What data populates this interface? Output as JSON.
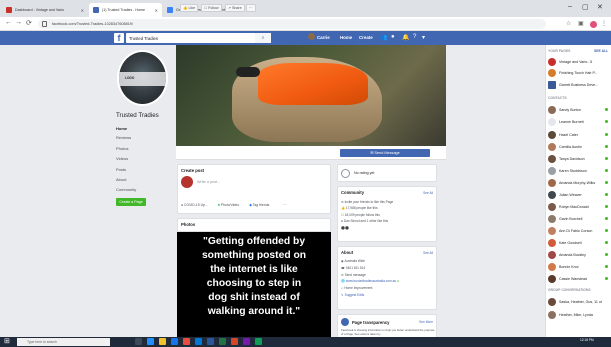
{
  "browser": {
    "tabs": [
      {
        "label": "Dashboard - Vintage and Vario",
        "color": "#c9302c"
      },
      {
        "label": "(1) Trusted Tradies - Home",
        "color": "#4267b2"
      },
      {
        "label": "Garrett Business Development",
        "color": "#3b82f6"
      }
    ],
    "url": "facebook.com/Trusted-Tradies-1028347608819/"
  },
  "fb": {
    "search_value": "Trusted Tradies",
    "nav": {
      "user": "Carrie",
      "home": "Home",
      "create": "Create"
    }
  },
  "page": {
    "name": "Trusted Tradies",
    "profile_badge": "LOGO",
    "left_nav": [
      "Home",
      "Reviews",
      "Photos",
      "Videos",
      "Posts",
      "About",
      "Community"
    ],
    "create_page": "Create a Page"
  },
  "actions": {
    "like": "Like",
    "follow": "Follow",
    "share": "Share",
    "more": "···",
    "send": "Send Message"
  },
  "create_post": {
    "title": "Create post",
    "placeholder": "Write a post...",
    "buttons": [
      "COVID-19 Up...",
      "Photo/Video",
      "Tag friends"
    ]
  },
  "photos": {
    "title": "Photos"
  },
  "quote": {
    "lines": [
      "\"Getting offended by",
      "something posted on",
      "the internet is like",
      "choosing to step in",
      "dog shit instead of",
      "walking around it.\""
    ]
  },
  "rating": {
    "text": "No rating yet"
  },
  "community": {
    "title": "Community",
    "see_all": "See All",
    "rows": [
      "Invite your friends to like this Page",
      "17,988 people like this",
      "18,009 people follow this",
      "Dan Sinnot and 1 other like this"
    ]
  },
  "about": {
    "title": "About",
    "see_all": "See All",
    "rows": [
      "Australia Wide",
      "0401 811 514",
      "Send message",
      "www.trustedtradiesaustralia.com.au",
      "Home Improvement",
      "Suggest Edits"
    ]
  },
  "transparency": {
    "title": "Page transparency",
    "see_more": "See More",
    "body": "Facebook is showing information to help you better understand the purpose of a Page. See actions taken by"
  },
  "right_bar": {
    "your_pages": "YOUR PAGES",
    "see_all": "SEE ALL",
    "pages": [
      "Vintage and Vario...5",
      "Finishing Touch Hair P...",
      "Garrett Business Deve..."
    ],
    "contacts_label": "CONTACTS",
    "contacts": [
      "Sandy Burton",
      "Leanne Burnett",
      "Hazel Cater",
      "Camilla Austin",
      "Tanya Davidson",
      "Karen Studdrison",
      "Amanda Murphy-Wilks",
      "Julian Weaver",
      "Robyn MacDonald",
      "Gavin Burchell",
      "Ann Di Fabio Corson",
      "Kate Goodsell",
      "Amanda Buckley",
      "Bonnie Knol",
      "Cassie Wanstead"
    ],
    "group_label": "GROUP CONVERSATIONS",
    "groups": [
      "Saska, Heather, Gus, 11 ot",
      "Heather, Mike, Lynda"
    ]
  },
  "taskbar": {
    "search": "Type here to search",
    "time": "12:18 PM"
  }
}
